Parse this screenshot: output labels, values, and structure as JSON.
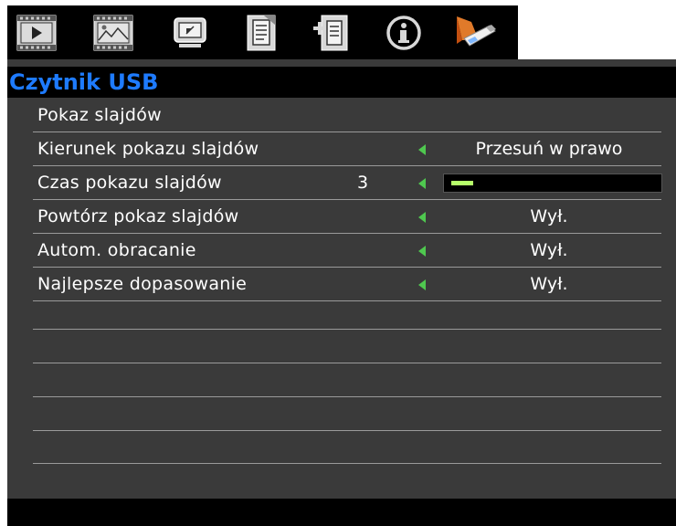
{
  "tabs": [
    {
      "name": "image-tab",
      "icon": "play-screen-icon"
    },
    {
      "name": "display-tab",
      "icon": "picture-icon"
    },
    {
      "name": "screen-tab",
      "icon": "monitor-icon"
    },
    {
      "name": "setup-tab",
      "icon": "document-icon"
    },
    {
      "name": "advanced-tab",
      "icon": "document-plus-icon"
    },
    {
      "name": "info-tab",
      "icon": "info-icon"
    },
    {
      "name": "usb-reader-tab",
      "icon": "usb-drive-icon",
      "selected": true
    }
  ],
  "panel": {
    "title": "Czytnik USB"
  },
  "rows": [
    {
      "label": "Pokaz slajdów"
    },
    {
      "label": "Kierunek pokazu slajdów",
      "value": "Przesuń w prawo"
    },
    {
      "label": "Czas pokazu slajdów",
      "number": "3",
      "slider_level": 0.11
    },
    {
      "label": "Powtórz pokaz slajdów",
      "value": "Wył."
    },
    {
      "label": "Autom. obracanie",
      "value": "Wył."
    },
    {
      "label": "Najlepsze dopasowanie",
      "value": "Wył."
    }
  ],
  "colors": {
    "title_blue": "#1e7bff",
    "arrow_green": "#4fc84f",
    "slider_fill": "#b6ff6a",
    "panel_bg": "#3a3a3a"
  }
}
